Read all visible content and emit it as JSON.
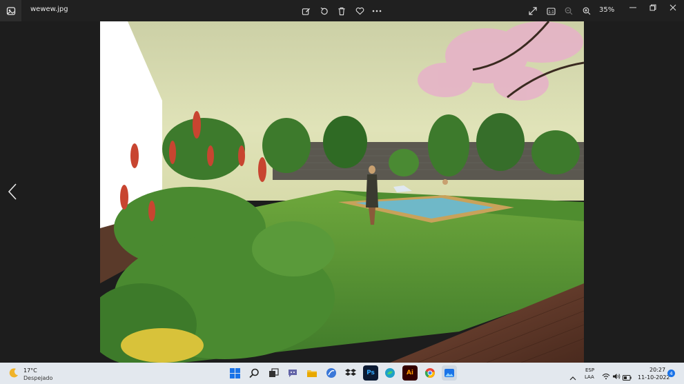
{
  "titlebar": {
    "filename": "wewew.jpg",
    "zoom": "35%",
    "icons": [
      "photos-app-icon",
      "edit-image-icon",
      "rotate-icon",
      "delete-icon",
      "favorite-icon",
      "more-icon",
      "fullscreen-icon",
      "actual-size-icon",
      "zoom-out-icon",
      "zoom-in-icon",
      "minimize-icon",
      "restore-icon",
      "close-icon"
    ]
  },
  "taskbar": {
    "weather_temp": "17°C",
    "weather_desc": "Despejado",
    "lang_line1": "ESP",
    "lang_line2": "LAA",
    "time": "20:27",
    "date": "11-10-2022",
    "notifications": "4"
  }
}
